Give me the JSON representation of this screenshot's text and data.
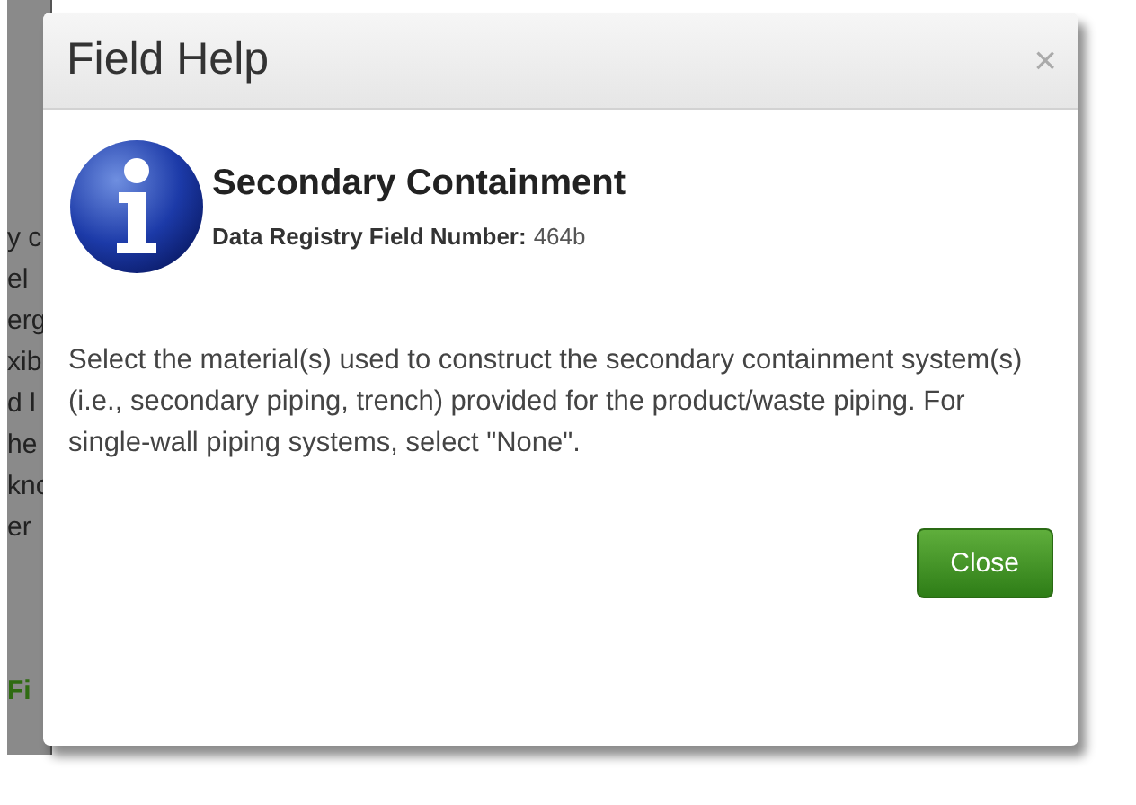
{
  "background_page": {
    "text_fragments": [
      {
        "text": "y c",
        "kind": "plain"
      },
      {
        "text": "el",
        "kind": "plain"
      },
      {
        "text": "erg",
        "kind": "plain"
      },
      {
        "text": "xib",
        "kind": "plain"
      },
      {
        "text": "d l",
        "kind": "plain"
      },
      {
        "text": "he",
        "kind": "plain"
      },
      {
        "text": "knc",
        "kind": "plain"
      },
      {
        "text": "er",
        "kind": "plain"
      },
      {
        "text": "Fi",
        "kind": "link"
      }
    ]
  },
  "dialog": {
    "title": "Field Help",
    "close_glyph": "×",
    "heading": "Secondary Containment",
    "field_label": "Data Registry Field Number:",
    "field_number": "464b",
    "description": "Select the material(s) used to construct the secondary containment system(s) (i.e., secondary piping, trench) provided for the product/waste piping. For single-wall piping systems, select \"None\".",
    "buttons": [
      "Close"
    ]
  }
}
